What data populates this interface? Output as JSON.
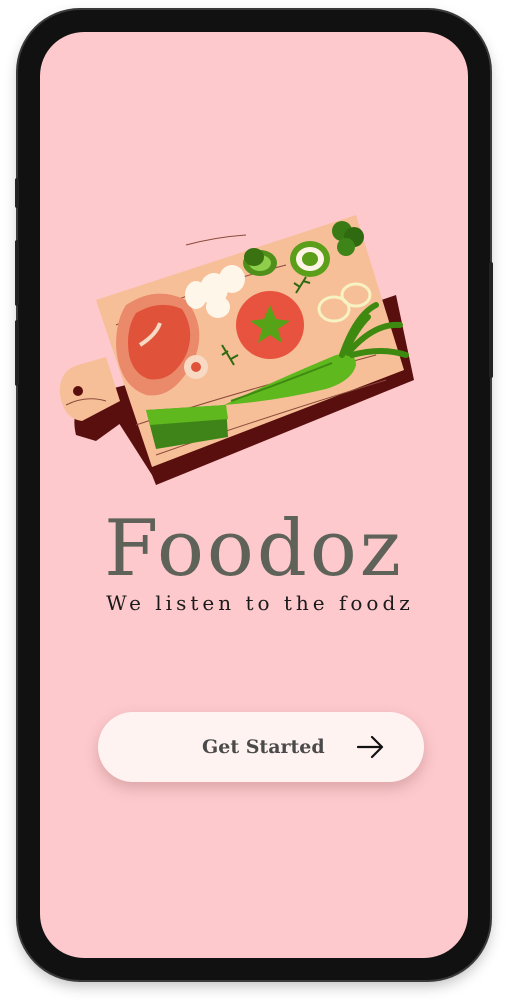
{
  "app": {
    "name": "Foodoz",
    "tagline": "We listen to the foodz"
  },
  "cta": {
    "label": "Get Started",
    "icon": "arrow-right-icon"
  },
  "illustration": {
    "subject": "cutting-board-with-vegetables"
  },
  "colors": {
    "screen_background": "#fdc9cc",
    "brand_text": "#5e6259",
    "button_background": "#fff3f2",
    "button_text": "#4a4a4a"
  }
}
